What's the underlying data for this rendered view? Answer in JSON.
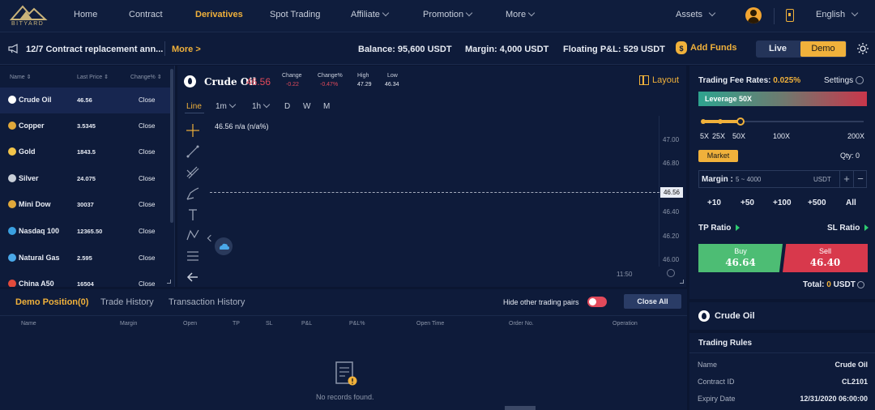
{
  "brand": {
    "name": "BITYARD",
    "accent": "#f0b13b"
  },
  "nav": {
    "home": "Home",
    "contract": "Contract",
    "derivatives": "Derivatives",
    "spot": "Spot Trading",
    "affiliate": "Affiliate",
    "promotion": "Promotion",
    "more": "More",
    "assets": "Assets",
    "language": "English"
  },
  "announcement": {
    "text": "12/7 Contract replacement ann...",
    "more": "More >"
  },
  "account": {
    "balance": "Balance: 95,600 USDT",
    "margin": "Margin: 4,000 USDT",
    "pnl": "Floating P&L: 529 USDT",
    "add_funds": "Add Funds",
    "live": "Live",
    "demo": "Demo"
  },
  "markets": {
    "headers": {
      "name": "Name ⇕",
      "price": "Last Price ⇕",
      "change": "Change% ⇕"
    },
    "rows": [
      {
        "name": "Crude Oil",
        "price": "46.56",
        "change": "Close",
        "icon": "oil-drop-icon"
      },
      {
        "name": "Copper",
        "price": "3.5345",
        "change": "Close",
        "icon": "copper-coin-icon"
      },
      {
        "name": "Gold",
        "price": "1843.5",
        "change": "Close",
        "icon": "gold-coin-icon"
      },
      {
        "name": "Silver",
        "price": "24.075",
        "change": "Close",
        "icon": "silver-coin-icon"
      },
      {
        "name": "Mini Dow",
        "price": "30037",
        "change": "Close",
        "icon": "dow-coin-icon"
      },
      {
        "name": "Nasdaq 100",
        "price": "12365.50",
        "change": "Close",
        "icon": "nasdaq-icon"
      },
      {
        "name": "Natural Gas",
        "price": "2.595",
        "change": "Close",
        "icon": "gas-icon"
      },
      {
        "name": "China A50",
        "price": "16504",
        "change": "Close",
        "icon": "china-icon"
      }
    ]
  },
  "chart": {
    "symbol": "Crude Oil",
    "price": "46.56",
    "stats": [
      {
        "label": "Change",
        "value": "-0.22",
        "color": "#e24a5b"
      },
      {
        "label": "Change%",
        "value": "-0.47%",
        "color": "#e24a5b"
      },
      {
        "label": "High",
        "value": "47.29",
        "color": "#e8ecf4"
      },
      {
        "label": "Low",
        "value": "46.34",
        "color": "#e8ecf4"
      }
    ],
    "layout": "Layout",
    "timeframes": {
      "line": "Line",
      "m1": "1m",
      "h1": "1h",
      "d": "D",
      "w": "W",
      "mo": "M"
    },
    "legend": "46.56  n/a (n/a%)",
    "y_ticks": [
      "47.00",
      "46.80",
      "46.40",
      "46.20",
      "46.00"
    ],
    "price_tag": "46.56",
    "x_label": "11:50"
  },
  "positions": {
    "tabs": {
      "demo": "Demo Position(0)",
      "trade": "Trade History",
      "transaction": "Transaction History"
    },
    "hide_label": "Hide other trading pairs",
    "close_all": "Close All",
    "columns": [
      "Name",
      "Margin",
      "Open",
      "TP",
      "SL",
      "P&L",
      "P&L%",
      "Open Time",
      "Order No.",
      "Operation"
    ],
    "empty": "No records found."
  },
  "order": {
    "fee_label": "Trading Fee Rates:",
    "fee_value": "0.025%",
    "settings": "Settings",
    "leverage": "Leverage 50X",
    "lev_levels": [
      "5X",
      "25X",
      "50X",
      "100X",
      "200X"
    ],
    "market": "Market",
    "qty": "Qty: 0",
    "margin_label": "Margin :",
    "margin_placeholder": "5 ~ 4000",
    "margin_unit": "USDT",
    "quick": [
      "+10",
      "+50",
      "+100",
      "+500",
      "All"
    ],
    "tp_ratio": "TP Ratio",
    "sl_ratio": "SL Ratio",
    "buy_label": "Buy",
    "buy_price": "46.64",
    "sell_label": "Sell",
    "sell_price": "46.40",
    "total_label": "Total:",
    "total_value": "0",
    "total_unit": "USDT"
  },
  "info": {
    "symbol": "Crude Oil",
    "rules_title": "Trading Rules",
    "rules": [
      {
        "k": "Name",
        "v": "Crude Oil"
      },
      {
        "k": "Contract ID",
        "v": "CL2101"
      },
      {
        "k": "Expiry Date",
        "v": "12/31/2020 06:00:00"
      }
    ]
  }
}
